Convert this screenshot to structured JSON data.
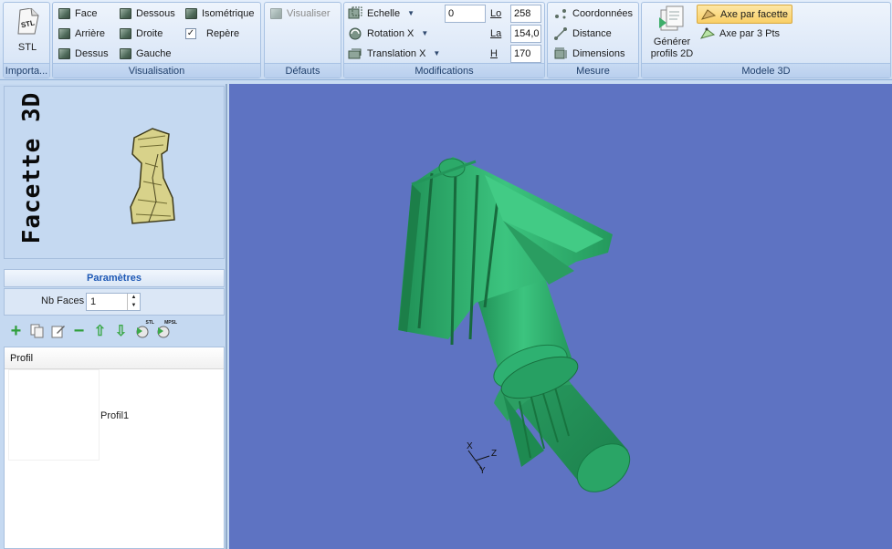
{
  "ribbon": {
    "import_group": {
      "title": "Importa...",
      "stl_label": "STL",
      "stl_icon_text": "STL"
    },
    "visualisation_group": {
      "title": "Visualisation",
      "buttons": [
        "Face",
        "Arrière",
        "Dessus",
        "Dessous",
        "Droite",
        "Gauche",
        "Isométrique",
        "Repère"
      ],
      "repere_checked": true
    },
    "defauts_group": {
      "title": "Défauts",
      "visualiser_label": "Visualiser"
    },
    "modifications_group": {
      "title": "Modifications",
      "echelle_label": "Echelle",
      "rotation_label": "Rotation X",
      "translation_label": "Translation X",
      "echelle_value": "0",
      "lo_label": "Lo",
      "lo_value": "258",
      "la_label": "La",
      "la_value": "154,0",
      "h_label": "H",
      "h_value": "170"
    },
    "mesure_group": {
      "title": "Mesure",
      "buttons": [
        "Coordonnées",
        "Distance",
        "Dimensions"
      ]
    },
    "modele3d_group": {
      "title": "Modele 3D",
      "generate_label_1": "Générer",
      "generate_label_2": "profils 2D",
      "axe_facette_label": "Axe par facette",
      "axe_3pts_label": "Axe par 3 Pts"
    }
  },
  "left_panel": {
    "vertical_title": "Facette 3D",
    "params_header": "Paramètres",
    "nb_faces_label": "Nb Faces",
    "nb_faces_value": "1",
    "profile_column": "Profil",
    "profiles": [
      "Profil1"
    ],
    "toolbar_badges": [
      "STL",
      "MPSL"
    ]
  },
  "viewport": {
    "axis_labels": {
      "x": "X",
      "y": "Y",
      "z": "Z"
    }
  },
  "colors": {
    "viewport_bg": "#5e73c2",
    "model_green": "#2fae6e",
    "highlight": "#f9cf66"
  }
}
